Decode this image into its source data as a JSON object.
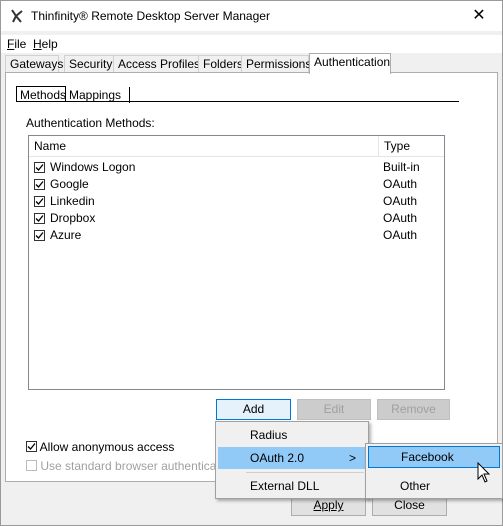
{
  "window": {
    "title": "Thinfinity® Remote Desktop Server Manager",
    "close_glyph": "✕"
  },
  "menubar": {
    "items": [
      {
        "label": "File",
        "accel": "F",
        "rest": "ile"
      },
      {
        "label": "Help",
        "accel": "H",
        "rest": "elp"
      }
    ]
  },
  "tabs": [
    "Gateways",
    "Security",
    "Access Profiles",
    "Folders",
    "Permissions",
    "Authentication"
  ],
  "subtabs": [
    "Methods",
    "Mappings"
  ],
  "auth_methods_label": "Authentication Methods:",
  "list": {
    "columns": [
      "Name",
      "Type"
    ],
    "rows": [
      {
        "name": "Windows Logon",
        "type": "Built-in",
        "checked": true
      },
      {
        "name": "Google",
        "type": "OAuth",
        "checked": true
      },
      {
        "name": "Linkedin",
        "type": "OAuth",
        "checked": true
      },
      {
        "name": "Dropbox",
        "type": "OAuth",
        "checked": true
      },
      {
        "name": "Azure",
        "type": "OAuth",
        "checked": true
      }
    ]
  },
  "buttons": {
    "add": "Add",
    "edit": "Edit",
    "remove": "Remove",
    "apply": "Apply",
    "close": "Close"
  },
  "options": {
    "allow_anonymous": "Allow anonymous access",
    "standard_browser_auth": "Use standard browser authentication"
  },
  "add_menu": {
    "items": [
      "Radius",
      "OAuth 2.0",
      "External DLL"
    ],
    "submenu_arrow": ">"
  },
  "oauth_submenu": {
    "items": [
      "Facebook",
      "Other"
    ]
  }
}
